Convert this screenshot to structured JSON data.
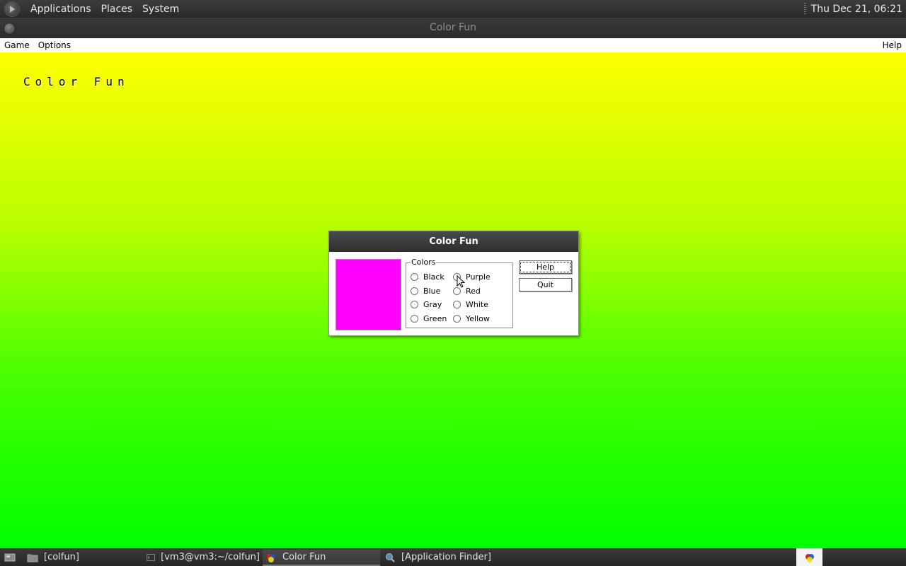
{
  "top_panel": {
    "menus": [
      "Applications",
      "Places",
      "System"
    ],
    "clock": "Thu Dec 21, 06:21"
  },
  "window": {
    "title": "Color Fun",
    "menubar": {
      "left": [
        "Game",
        "Options"
      ],
      "right": "Help"
    },
    "canvas_title": "Color Fun",
    "canvas_colors": {
      "top": "#ffff00",
      "bottom": "#00ff00"
    }
  },
  "dialog": {
    "title": "Color Fun",
    "swatch_color": "#ff00ff",
    "group_label": "Colors",
    "colors_left": [
      "Black",
      "Blue",
      "Gray",
      "Green"
    ],
    "colors_right": [
      "Purple",
      "Red",
      "White",
      "Yellow"
    ],
    "help_button": "Help",
    "quit_button": "Quit"
  },
  "taskbar": {
    "tasks": [
      "[colfun]",
      "[vm3@vm3:~/colfun]",
      "Color Fun",
      "[Application Finder]"
    ],
    "active_task": "Color Fun"
  }
}
